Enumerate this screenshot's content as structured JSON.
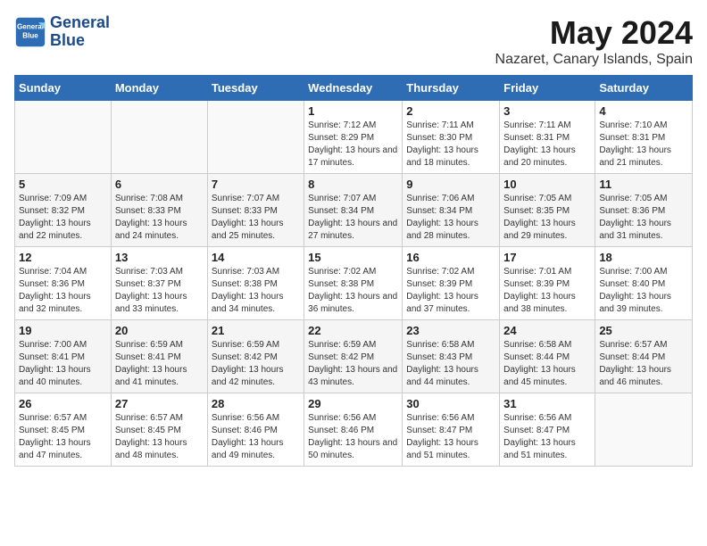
{
  "logo": {
    "line1": "General",
    "line2": "Blue"
  },
  "title": "May 2024",
  "location": "Nazaret, Canary Islands, Spain",
  "weekdays": [
    "Sunday",
    "Monday",
    "Tuesday",
    "Wednesday",
    "Thursday",
    "Friday",
    "Saturday"
  ],
  "weeks": [
    [
      {
        "day": "",
        "info": ""
      },
      {
        "day": "",
        "info": ""
      },
      {
        "day": "",
        "info": ""
      },
      {
        "day": "1",
        "info": "Sunrise: 7:12 AM\nSunset: 8:29 PM\nDaylight: 13 hours and 17 minutes."
      },
      {
        "day": "2",
        "info": "Sunrise: 7:11 AM\nSunset: 8:30 PM\nDaylight: 13 hours and 18 minutes."
      },
      {
        "day": "3",
        "info": "Sunrise: 7:11 AM\nSunset: 8:31 PM\nDaylight: 13 hours and 20 minutes."
      },
      {
        "day": "4",
        "info": "Sunrise: 7:10 AM\nSunset: 8:31 PM\nDaylight: 13 hours and 21 minutes."
      }
    ],
    [
      {
        "day": "5",
        "info": "Sunrise: 7:09 AM\nSunset: 8:32 PM\nDaylight: 13 hours and 22 minutes."
      },
      {
        "day": "6",
        "info": "Sunrise: 7:08 AM\nSunset: 8:33 PM\nDaylight: 13 hours and 24 minutes."
      },
      {
        "day": "7",
        "info": "Sunrise: 7:07 AM\nSunset: 8:33 PM\nDaylight: 13 hours and 25 minutes."
      },
      {
        "day": "8",
        "info": "Sunrise: 7:07 AM\nSunset: 8:34 PM\nDaylight: 13 hours and 27 minutes."
      },
      {
        "day": "9",
        "info": "Sunrise: 7:06 AM\nSunset: 8:34 PM\nDaylight: 13 hours and 28 minutes."
      },
      {
        "day": "10",
        "info": "Sunrise: 7:05 AM\nSunset: 8:35 PM\nDaylight: 13 hours and 29 minutes."
      },
      {
        "day": "11",
        "info": "Sunrise: 7:05 AM\nSunset: 8:36 PM\nDaylight: 13 hours and 31 minutes."
      }
    ],
    [
      {
        "day": "12",
        "info": "Sunrise: 7:04 AM\nSunset: 8:36 PM\nDaylight: 13 hours and 32 minutes."
      },
      {
        "day": "13",
        "info": "Sunrise: 7:03 AM\nSunset: 8:37 PM\nDaylight: 13 hours and 33 minutes."
      },
      {
        "day": "14",
        "info": "Sunrise: 7:03 AM\nSunset: 8:38 PM\nDaylight: 13 hours and 34 minutes."
      },
      {
        "day": "15",
        "info": "Sunrise: 7:02 AM\nSunset: 8:38 PM\nDaylight: 13 hours and 36 minutes."
      },
      {
        "day": "16",
        "info": "Sunrise: 7:02 AM\nSunset: 8:39 PM\nDaylight: 13 hours and 37 minutes."
      },
      {
        "day": "17",
        "info": "Sunrise: 7:01 AM\nSunset: 8:39 PM\nDaylight: 13 hours and 38 minutes."
      },
      {
        "day": "18",
        "info": "Sunrise: 7:00 AM\nSunset: 8:40 PM\nDaylight: 13 hours and 39 minutes."
      }
    ],
    [
      {
        "day": "19",
        "info": "Sunrise: 7:00 AM\nSunset: 8:41 PM\nDaylight: 13 hours and 40 minutes."
      },
      {
        "day": "20",
        "info": "Sunrise: 6:59 AM\nSunset: 8:41 PM\nDaylight: 13 hours and 41 minutes."
      },
      {
        "day": "21",
        "info": "Sunrise: 6:59 AM\nSunset: 8:42 PM\nDaylight: 13 hours and 42 minutes."
      },
      {
        "day": "22",
        "info": "Sunrise: 6:59 AM\nSunset: 8:42 PM\nDaylight: 13 hours and 43 minutes."
      },
      {
        "day": "23",
        "info": "Sunrise: 6:58 AM\nSunset: 8:43 PM\nDaylight: 13 hours and 44 minutes."
      },
      {
        "day": "24",
        "info": "Sunrise: 6:58 AM\nSunset: 8:44 PM\nDaylight: 13 hours and 45 minutes."
      },
      {
        "day": "25",
        "info": "Sunrise: 6:57 AM\nSunset: 8:44 PM\nDaylight: 13 hours and 46 minutes."
      }
    ],
    [
      {
        "day": "26",
        "info": "Sunrise: 6:57 AM\nSunset: 8:45 PM\nDaylight: 13 hours and 47 minutes."
      },
      {
        "day": "27",
        "info": "Sunrise: 6:57 AM\nSunset: 8:45 PM\nDaylight: 13 hours and 48 minutes."
      },
      {
        "day": "28",
        "info": "Sunrise: 6:56 AM\nSunset: 8:46 PM\nDaylight: 13 hours and 49 minutes."
      },
      {
        "day": "29",
        "info": "Sunrise: 6:56 AM\nSunset: 8:46 PM\nDaylight: 13 hours and 50 minutes."
      },
      {
        "day": "30",
        "info": "Sunrise: 6:56 AM\nSunset: 8:47 PM\nDaylight: 13 hours and 51 minutes."
      },
      {
        "day": "31",
        "info": "Sunrise: 6:56 AM\nSunset: 8:47 PM\nDaylight: 13 hours and 51 minutes."
      },
      {
        "day": "",
        "info": ""
      }
    ]
  ]
}
